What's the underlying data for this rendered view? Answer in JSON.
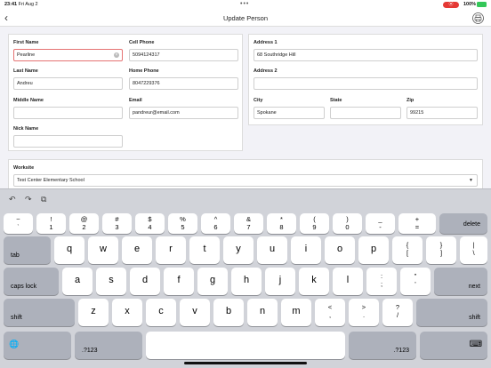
{
  "status": {
    "time": "23:41",
    "date": "Fri Aug 2",
    "dots": "•••",
    "record_label": "⦿",
    "battery_pct": "100%"
  },
  "nav": {
    "back_glyph": "‹",
    "title": "Update Person"
  },
  "person": {
    "first_name": {
      "label": "First Name",
      "value": "Pearline"
    },
    "last_name": {
      "label": "Last Name",
      "value": "Andreu"
    },
    "middle_name": {
      "label": "Middle Name",
      "value": ""
    },
    "nick_name": {
      "label": "Nick Name",
      "value": ""
    },
    "cell_phone": {
      "label": "Cell Phone",
      "value": "5094124317"
    },
    "home_phone": {
      "label": "Home Phone",
      "value": "8047229376"
    },
    "email": {
      "label": "Email",
      "value": "pandreur@email.com"
    }
  },
  "address": {
    "address1": {
      "label": "Address 1",
      "value": "68 Southridge Hill"
    },
    "address2": {
      "label": "Address 2",
      "value": ""
    },
    "city": {
      "label": "City",
      "value": "Spokane"
    },
    "state": {
      "label": "State",
      "value": ""
    },
    "zip": {
      "label": "Zip",
      "value": "99215"
    }
  },
  "worksite": {
    "label": "Worksite",
    "value": "Test Center Elementary School"
  },
  "toolbar": {
    "undo": "↶",
    "redo": "↷",
    "paste": "⧉"
  },
  "keyboard": {
    "row_numbers": [
      {
        "top": "~",
        "bottom": "`"
      },
      {
        "top": "!",
        "bottom": "1"
      },
      {
        "top": "@",
        "bottom": "2"
      },
      {
        "top": "#",
        "bottom": "3"
      },
      {
        "top": "$",
        "bottom": "4"
      },
      {
        "top": "%",
        "bottom": "5"
      },
      {
        "top": "^",
        "bottom": "6"
      },
      {
        "top": "&",
        "bottom": "7"
      },
      {
        "top": "*",
        "bottom": "8"
      },
      {
        "top": "(",
        "bottom": "9"
      },
      {
        "top": ")",
        "bottom": "0"
      },
      {
        "top": "_",
        "bottom": "-"
      },
      {
        "top": "+",
        "bottom": "="
      }
    ],
    "delete": "delete",
    "tab": "tab",
    "row_q": [
      "q",
      "w",
      "e",
      "r",
      "t",
      "y",
      "u",
      "i",
      "o",
      "p"
    ],
    "brace_open": {
      "top": "{",
      "bottom": "["
    },
    "brace_close": {
      "top": "}",
      "bottom": "]"
    },
    "pipe": {
      "top": "|",
      "bottom": "\\"
    },
    "caps_lock": "caps lock",
    "row_a": [
      "a",
      "s",
      "d",
      "f",
      "g",
      "h",
      "j",
      "k",
      "l"
    ],
    "colon": {
      "top": ":",
      "bottom": ";"
    },
    "quote": {
      "top": "\"",
      "bottom": "'"
    },
    "next": "next",
    "shift": "shift",
    "row_z": [
      "z",
      "x",
      "c",
      "v",
      "b",
      "n",
      "m"
    ],
    "lt": {
      "top": "<",
      "bottom": ","
    },
    "gt": {
      "top": ">",
      "bottom": "."
    },
    "question": {
      "top": "?",
      "bottom": "/"
    },
    "globe": "🌐",
    "num_switch": ".?123",
    "space": "",
    "hide": "⌨"
  }
}
